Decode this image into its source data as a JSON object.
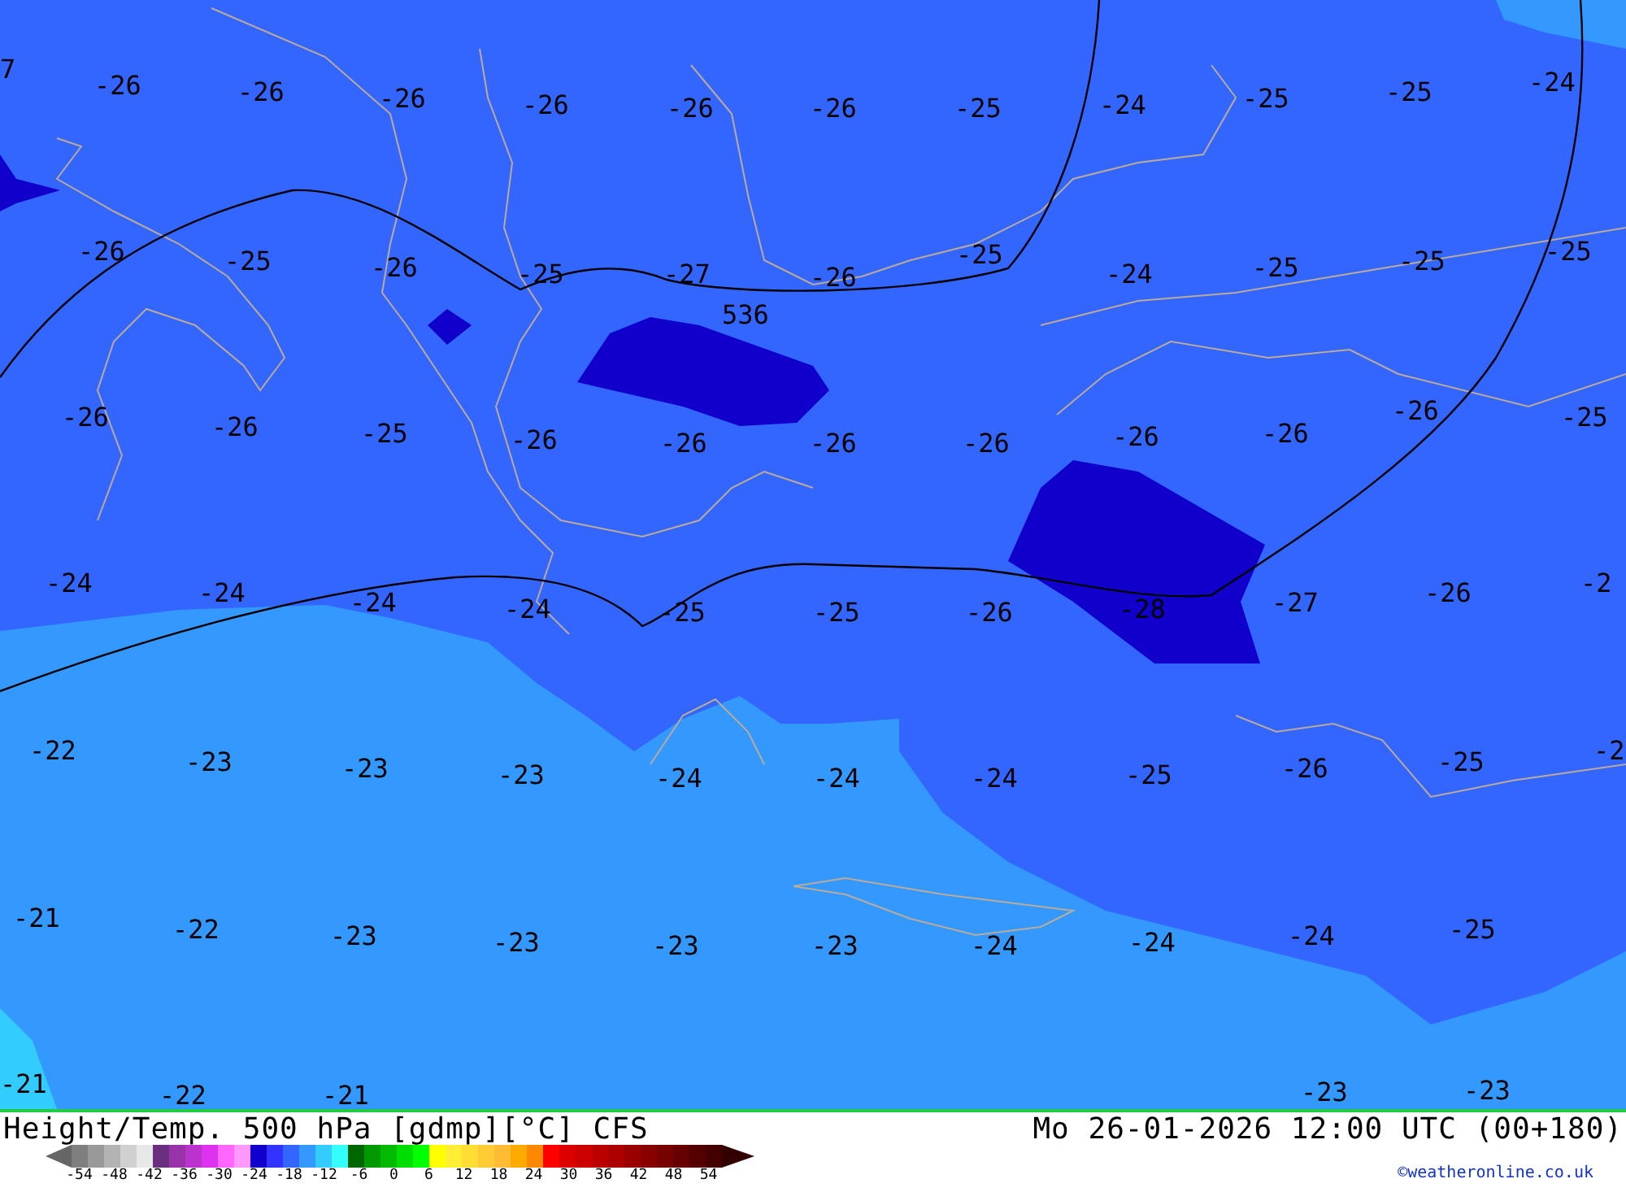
{
  "map": {
    "label_rows": [
      [
        "7",
        "-26",
        "-26",
        "-26",
        "-26",
        "-26",
        "-26",
        "-25",
        "-24",
        "-25",
        "-25",
        "-24"
      ],
      [
        "-26",
        "-25",
        "-26",
        "-25",
        "-27",
        "-26",
        "-25",
        "-24",
        "-25",
        "-25",
        "-25"
      ],
      [
        "-26",
        "-26",
        "-25",
        "-26",
        "-26",
        "-26",
        "-26",
        "-26",
        "-26",
        "-26",
        "-25"
      ],
      [
        "-24",
        "-24",
        "-24",
        "-24",
        "-25",
        "-25",
        "-26",
        "-28",
        "-27",
        "-26",
        "-2"
      ],
      [
        "-22",
        "-23",
        "-23",
        "-23",
        "-24",
        "-24",
        "-24",
        "-25",
        "-26",
        "-25",
        "-2"
      ],
      [
        "-21",
        "-22",
        "-23",
        "-23",
        "-23",
        "-23",
        "-24",
        "-24",
        "-24",
        "-25"
      ],
      [
        "-21",
        "-22",
        "-21",
        "-23",
        "-23"
      ]
    ],
    "contour_label": "536"
  },
  "footer": {
    "title": "Height/Temp. 500 hPa [gdmp][°C] CFS",
    "datetime": "Mo 26-01-2026 12:00 UTC (00+180)",
    "credit": "©weatheronline.co.uk",
    "colorbar": {
      "swatches": [
        {
          "color": "#7f7f7f"
        },
        {
          "color": "#999999"
        },
        {
          "color": "#b3b3b3"
        },
        {
          "color": "#d0d0d0"
        },
        {
          "color": "#e8e8e8"
        },
        {
          "color": "#6b2f7f"
        },
        {
          "color": "#9933aa"
        },
        {
          "color": "#bb33cc"
        },
        {
          "color": "#dd33ee"
        },
        {
          "color": "#ff66ff"
        },
        {
          "color": "#ff99ff"
        },
        {
          "color": "#1100cc"
        },
        {
          "color": "#3333ff"
        },
        {
          "color": "#3366ff"
        },
        {
          "color": "#3399ff"
        },
        {
          "color": "#33ccff"
        },
        {
          "color": "#33ffff"
        },
        {
          "color": "#006600"
        },
        {
          "color": "#009900"
        },
        {
          "color": "#00bb00"
        },
        {
          "color": "#00dd00"
        },
        {
          "color": "#00ff00"
        },
        {
          "color": "#ffff00"
        },
        {
          "color": "#ffee33"
        },
        {
          "color": "#ffdd33"
        },
        {
          "color": "#ffcc33"
        },
        {
          "color": "#ffbb33"
        },
        {
          "color": "#ffaa00"
        },
        {
          "color": "#ff8800"
        },
        {
          "color": "#ff0000"
        },
        {
          "color": "#dd0000"
        },
        {
          "color": "#cc0000"
        },
        {
          "color": "#bb0000"
        },
        {
          "color": "#aa0000"
        },
        {
          "color": "#990000"
        },
        {
          "color": "#880000"
        },
        {
          "color": "#770000"
        },
        {
          "color": "#660000"
        },
        {
          "color": "#550000"
        },
        {
          "color": "#440000"
        }
      ],
      "ticks": [
        "-54",
        "-48",
        "-42",
        "-36",
        "-30",
        "-24",
        "-18",
        "-12",
        "-6",
        "0",
        "6",
        "12",
        "18",
        "24",
        "30",
        "36",
        "42",
        "48",
        "54"
      ]
    }
  }
}
